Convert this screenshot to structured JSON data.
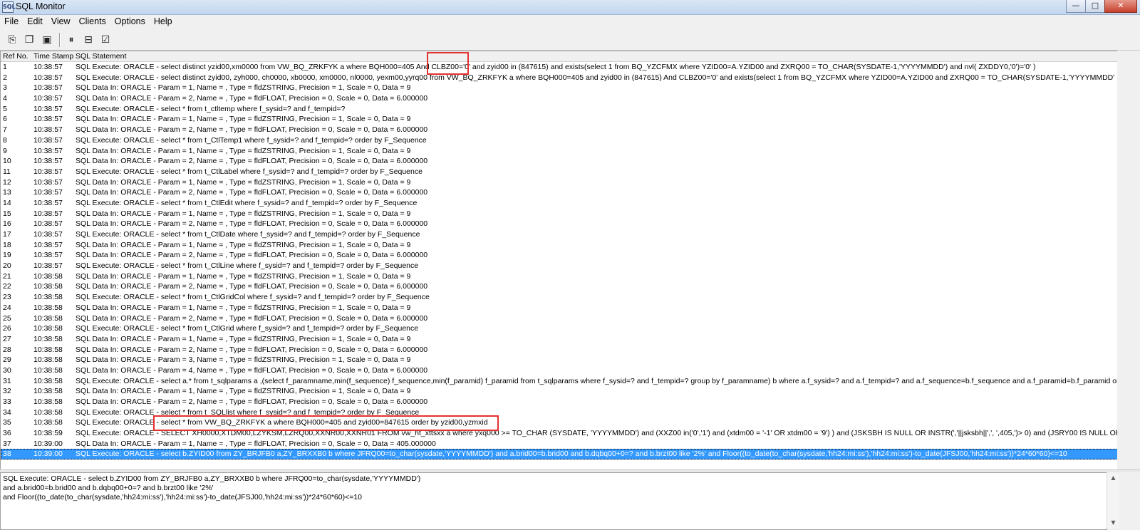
{
  "window": {
    "title": "SQL Monitor",
    "app_icon_glyph": "SQL",
    "buttons": {
      "minimize": "—",
      "maximize": "□",
      "close": "✕"
    }
  },
  "menu": [
    "File",
    "Edit",
    "View",
    "Clients",
    "Options",
    "Help"
  ],
  "toolbar": [
    {
      "icon": "copy-records-icon",
      "glyph": "⎘"
    },
    {
      "icon": "copy-icon",
      "glyph": "❐"
    },
    {
      "icon": "save-icon",
      "glyph": "▣"
    },
    {
      "icon": "pause-icon",
      "glyph": "⏸"
    },
    {
      "icon": "panes-icon",
      "glyph": "⊟"
    },
    {
      "icon": "checklist-icon",
      "glyph": "☑"
    }
  ],
  "grid": {
    "columns": [
      "Ref No.",
      "Time Stamp",
      "SQL Statement"
    ],
    "selected_index": 37,
    "rows": [
      [
        "1",
        "10:38:57",
        "SQL Execute: ORACLE - select distinct yzid00,xm0000 from VW_BQ_ZRKFYK a where BQH000=405 And CLBZ00='0' and zyid00 in (847615)  and exists(select 1 from BQ_YZCFMX where YZID00=A.YZID00  and ZXRQ00 = TO_CHAR(SYSDATE-1,'YYYYMMDD')  and nvl( ZXDDY0,'0')='0' )"
      ],
      [
        "2",
        "10:38:57",
        "SQL Execute: ORACLE - select distinct zyid00, zyh000, ch0000, xb0000, xm0000, nl0000, yexm00,yyrq00 from VW_BQ_ZRKFYK a  where BQH000=405  and zyid00 in (847615)  And CLBZ00='0' and exists(select 1 from BQ_YZCFMX where YZID00=A.YZID00   and ZXRQ00 = TO_CHAR(SYSDATE-1,'YYYYMMDD'"
      ],
      [
        "3",
        "10:38:57",
        "SQL Data In: ORACLE - Param = 1, Name = , Type = fldZSTRING, Precision = 1, Scale = 0, Data = 9"
      ],
      [
        "4",
        "10:38:57",
        "SQL Data In: ORACLE - Param = 2, Name = , Type = fldFLOAT, Precision = 0, Scale = 0, Data = 6.000000"
      ],
      [
        "5",
        "10:38:57",
        "SQL Execute: ORACLE - select * from t_ctltemp    where f_sysid=? and f_tempid=?"
      ],
      [
        "6",
        "10:38:57",
        "SQL Data In: ORACLE - Param = 1, Name = , Type = fldZSTRING, Precision = 1, Scale = 0, Data = 9"
      ],
      [
        "7",
        "10:38:57",
        "SQL Data In: ORACLE - Param = 2, Name = , Type = fldFLOAT, Precision = 0, Scale = 0, Data = 6.000000"
      ],
      [
        "8",
        "10:38:57",
        "SQL Execute: ORACLE - select * from t_CtlTemp1    where f_sysid=? and f_tempid=? order by F_Sequence"
      ],
      [
        "9",
        "10:38:57",
        "SQL Data In: ORACLE - Param = 1, Name = , Type = fldZSTRING, Precision = 1, Scale = 0, Data = 9"
      ],
      [
        "10",
        "10:38:57",
        "SQL Data In: ORACLE - Param = 2, Name = , Type = fldFLOAT, Precision = 0, Scale = 0, Data = 6.000000"
      ],
      [
        "11",
        "10:38:57",
        "SQL Execute: ORACLE - select * from t_CtlLabel    where f_sysid=? and f_tempid=? order by F_Sequence"
      ],
      [
        "12",
        "10:38:57",
        "SQL Data In: ORACLE - Param = 1, Name = , Type = fldZSTRING, Precision = 1, Scale = 0, Data = 9"
      ],
      [
        "13",
        "10:38:57",
        "SQL Data In: ORACLE - Param = 2, Name = , Type = fldFLOAT, Precision = 0, Scale = 0, Data = 6.000000"
      ],
      [
        "14",
        "10:38:57",
        "SQL Execute: ORACLE - select * from t_CtlEdit    where f_sysid=? and f_tempid=? order by F_Sequence"
      ],
      [
        "15",
        "10:38:57",
        "SQL Data In: ORACLE - Param = 1, Name = , Type = fldZSTRING, Precision = 1, Scale = 0, Data = 9"
      ],
      [
        "16",
        "10:38:57",
        "SQL Data In: ORACLE - Param = 2, Name = , Type = fldFLOAT, Precision = 0, Scale = 0, Data = 6.000000"
      ],
      [
        "17",
        "10:38:57",
        "SQL Execute: ORACLE - select * from t_CtlDate    where f_sysid=? and f_tempid=? order by F_Sequence"
      ],
      [
        "18",
        "10:38:57",
        "SQL Data In: ORACLE - Param = 1, Name = , Type = fldZSTRING, Precision = 1, Scale = 0, Data = 9"
      ],
      [
        "19",
        "10:38:57",
        "SQL Data In: ORACLE - Param = 2, Name = , Type = fldFLOAT, Precision = 0, Scale = 0, Data = 6.000000"
      ],
      [
        "20",
        "10:38:57",
        "SQL Execute: ORACLE - select * from t_CtlLine    where f_sysid=? and f_tempid=? order by F_Sequence"
      ],
      [
        "21",
        "10:38:58",
        "SQL Data In: ORACLE - Param = 1, Name = , Type = fldZSTRING, Precision = 1, Scale = 0, Data = 9"
      ],
      [
        "22",
        "10:38:58",
        "SQL Data In: ORACLE - Param = 2, Name = , Type = fldFLOAT, Precision = 0, Scale = 0, Data = 6.000000"
      ],
      [
        "23",
        "10:38:58",
        "SQL Execute: ORACLE - select * from t_CtlGridCol where f_sysid=? and f_tempid=? order by F_Sequence"
      ],
      [
        "24",
        "10:38:58",
        "SQL Data In: ORACLE - Param = 1, Name = , Type = fldZSTRING, Precision = 1, Scale = 0, Data = 9"
      ],
      [
        "25",
        "10:38:58",
        "SQL Data In: ORACLE - Param = 2, Name = , Type = fldFLOAT, Precision = 0, Scale = 0, Data = 6.000000"
      ],
      [
        "26",
        "10:38:58",
        "SQL Execute: ORACLE - select * from t_CtlGrid    where f_sysid=? and f_tempid=? order by F_Sequence"
      ],
      [
        "27",
        "10:38:58",
        "SQL Data In: ORACLE - Param = 1, Name = , Type = fldZSTRING, Precision = 1, Scale = 0, Data = 9"
      ],
      [
        "28",
        "10:38:58",
        "SQL Data In: ORACLE - Param = 2, Name = , Type = fldFLOAT, Precision = 0, Scale = 0, Data = 6.000000"
      ],
      [
        "29",
        "10:38:58",
        "SQL Data In: ORACLE - Param = 3, Name = , Type = fldZSTRING, Precision = 1, Scale = 0, Data = 9"
      ],
      [
        "30",
        "10:38:58",
        "SQL Data In: ORACLE - Param = 4, Name = , Type = fldFLOAT, Precision = 0, Scale = 0, Data = 6.000000"
      ],
      [
        "31",
        "10:38:58",
        "SQL Execute: ORACLE - select a.* from t_sqlparams a ,(select f_paramname,min(f_sequence) f_sequence,min(f_paramid) f_paramid from t_sqlparams where f_sysid=? and f_tempid=? group by f_paramname) b where a.f_sysid=? and a.f_tempid=? and a.f_sequence=b.f_sequence and a.f_paramid=b.f_paramid order by"
      ],
      [
        "32",
        "10:38:58",
        "SQL Data In: ORACLE - Param = 1, Name = , Type = fldZSTRING, Precision = 1, Scale = 0, Data = 9"
      ],
      [
        "33",
        "10:38:58",
        "SQL Data In: ORACLE - Param = 2, Name = , Type = fldFLOAT, Precision = 0, Scale = 0, Data = 6.000000"
      ],
      [
        "34",
        "10:38:58",
        "SQL Execute: ORACLE - select * from t_SQLlist    where f_sysid=? and f_tempid=? order by F_Sequence"
      ],
      [
        "35",
        "10:38:58",
        "SQL Execute: ORACLE - select * from VW_BQ_ZRKFYK a  where BQH000=405 and zyid00=847615 order by yzid00,yzmxid"
      ],
      [
        "36",
        "10:38:59",
        "SQL Execute: ORACLE - SELECT XH0000,XTDM00,LZYKSM,LZRQ00,XXNR00,XXNR01 FROM vw_ht_xttsxx a where yxq000 >= TO_CHAR (SYSDATE, 'YYYYMMDD') and (XXZ00 in('0','1') and (xtdm00 = '-1' OR xtdm00 = '9') ) and (JSKSBH IS NULL OR INSTR(','||jsksbh||',', ',405,')> 0) and (JSRY00 IS NULL OR"
      ],
      [
        "37",
        "10:39:00",
        "SQL Data In: ORACLE - Param = 1, Name = , Type = fldFLOAT, Precision = 0, Scale = 0, Data = 405.000000"
      ],
      [
        "38",
        "10:39:00",
        "SQL Execute: ORACLE - select b.ZYID00 from ZY_BRJFB0 a,ZY_BRXXB0 b where JFRQ00=to_char(sysdate,'YYYYMMDD')  and a.brid00=b.brid00 and b.dqbq00+0=? and b.brzt00 like '2%'  and Floor((to_date(to_char(sysdate,'hh24:mi:ss'),'hh24:mi:ss')-to_date(JFSJ00,'hh24:mi:ss'))*24*60*60)<=10"
      ]
    ]
  },
  "detail": {
    "lines": [
      "SQL Execute: ORACLE - select b.ZYID00 from ZY_BRJFB0 a,ZY_BRXXB0 b where JFRQ00=to_char(sysdate,'YYYYMMDD')",
      " and a.brid00=b.brid00 and b.dqbq00+0=? and b.brzt00 like '2%'",
      " and Floor((to_date(to_char(sysdate,'hh24:mi:ss'),'hh24:mi:ss')-to_date(JFSJ00,'hh24:mi:ss'))*24*60*60)<=10"
    ]
  },
  "scrollbar": {
    "up": "▲",
    "down": "▼"
  },
  "colors": {
    "selection": "#3399ff",
    "annotation": "#e53030"
  }
}
